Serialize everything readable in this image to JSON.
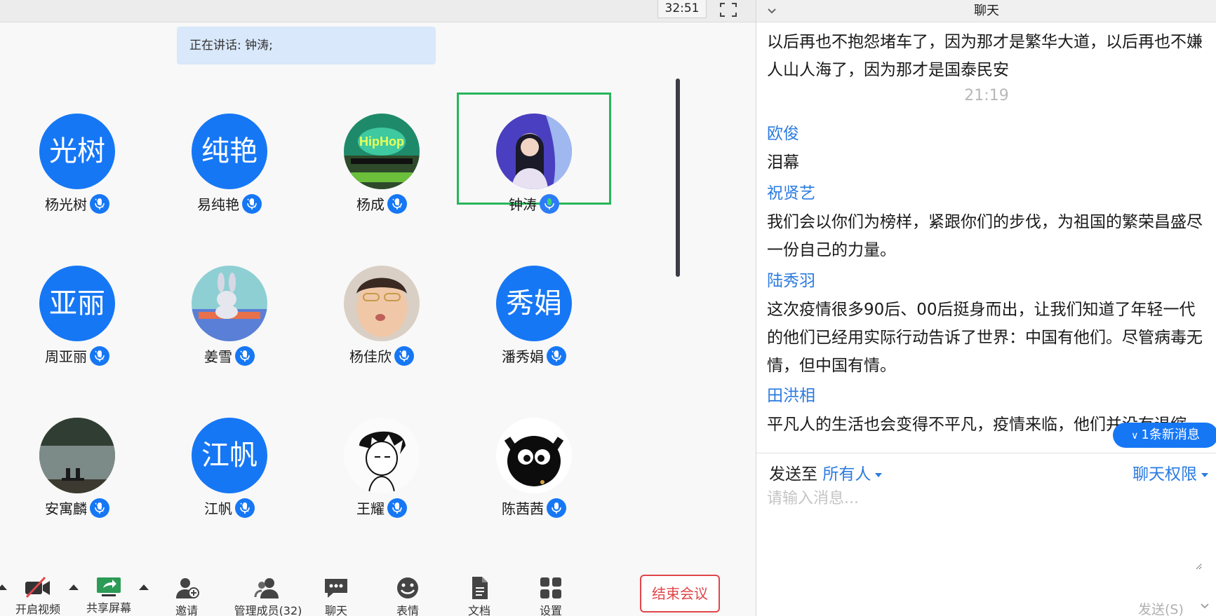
{
  "meeting": {
    "timer": "32:51",
    "speaking_banner": "正在讲话: 钟涛;",
    "participants": [
      {
        "name": "杨光树",
        "avatar_text": "光树",
        "avatar_type": "text",
        "mic": "on"
      },
      {
        "name": "易纯艳",
        "avatar_text": "纯艳",
        "avatar_type": "text",
        "mic": "on"
      },
      {
        "name": "杨成",
        "avatar_text": "",
        "avatar_type": "photo-hiphop",
        "mic": "on"
      },
      {
        "name": "钟涛",
        "avatar_text": "",
        "avatar_type": "photo-girl",
        "mic": "talking",
        "active": true
      },
      {
        "name": "周亚丽",
        "avatar_text": "亚丽",
        "avatar_type": "text",
        "mic": "on"
      },
      {
        "name": "姜雪",
        "avatar_text": "",
        "avatar_type": "photo-rabbit",
        "mic": "on"
      },
      {
        "name": "杨佳欣",
        "avatar_text": "",
        "avatar_type": "photo-child",
        "mic": "on"
      },
      {
        "name": "潘秀娟",
        "avatar_text": "秀娟",
        "avatar_type": "text",
        "mic": "on"
      },
      {
        "name": "安寓麟",
        "avatar_text": "",
        "avatar_type": "photo-lake",
        "mic": "on"
      },
      {
        "name": "江帆",
        "avatar_text": "江帆",
        "avatar_type": "text",
        "mic": "on"
      },
      {
        "name": "王耀",
        "avatar_text": "",
        "avatar_type": "photo-sketch",
        "mic": "on"
      },
      {
        "name": "陈茜茜",
        "avatar_text": "",
        "avatar_type": "photo-cat",
        "mic": "open"
      }
    ],
    "toolbar": {
      "video_label": "开启视频",
      "share_label": "共享屏幕",
      "invite_label": "邀请",
      "members_label": "管理成员(32)",
      "chat_label": "聊天",
      "emoji_label": "表情",
      "docs_label": "文档",
      "settings_label": "设置",
      "end_label": "结束会议"
    }
  },
  "chat": {
    "title": "聊天",
    "messages": {
      "m0_text": "以后再也不抱怨堵车了，因为那才是繁华大道，以后再也不嫌人山人海了，因为那才是国泰民安",
      "time": "21:19",
      "m1_sender": "欧俊",
      "m1_text": "泪幕",
      "m2_sender": "祝贤艺",
      "m2_text": "我们会以你们为榜样，紧跟你们的步伐，为祖国的繁荣昌盛尽一份自己的力量。",
      "m3_sender": "陆秀羽",
      "m3_text": "这次疫情很多90后、00后挺身而出，让我们知道了年轻一代的他们已经用实际行动告诉了世界：中国有他们。尽管病毒无情，但中国有情。",
      "m4_sender": "田洪相",
      "m4_text": "平凡人的生活也会变得不平凡，疫情来临，他们并没有退缩"
    },
    "new_messages": "1条新消息",
    "send_to_label": "发送至",
    "send_to_value": "所有人",
    "permissions_label": "聊天权限",
    "input_placeholder": "请输入消息...",
    "send_label": "发送(S)"
  },
  "colors": {
    "accent": "#1677f5",
    "active_border": "#28b55b",
    "end_button": "#e0464a",
    "link": "#2b7be0"
  }
}
